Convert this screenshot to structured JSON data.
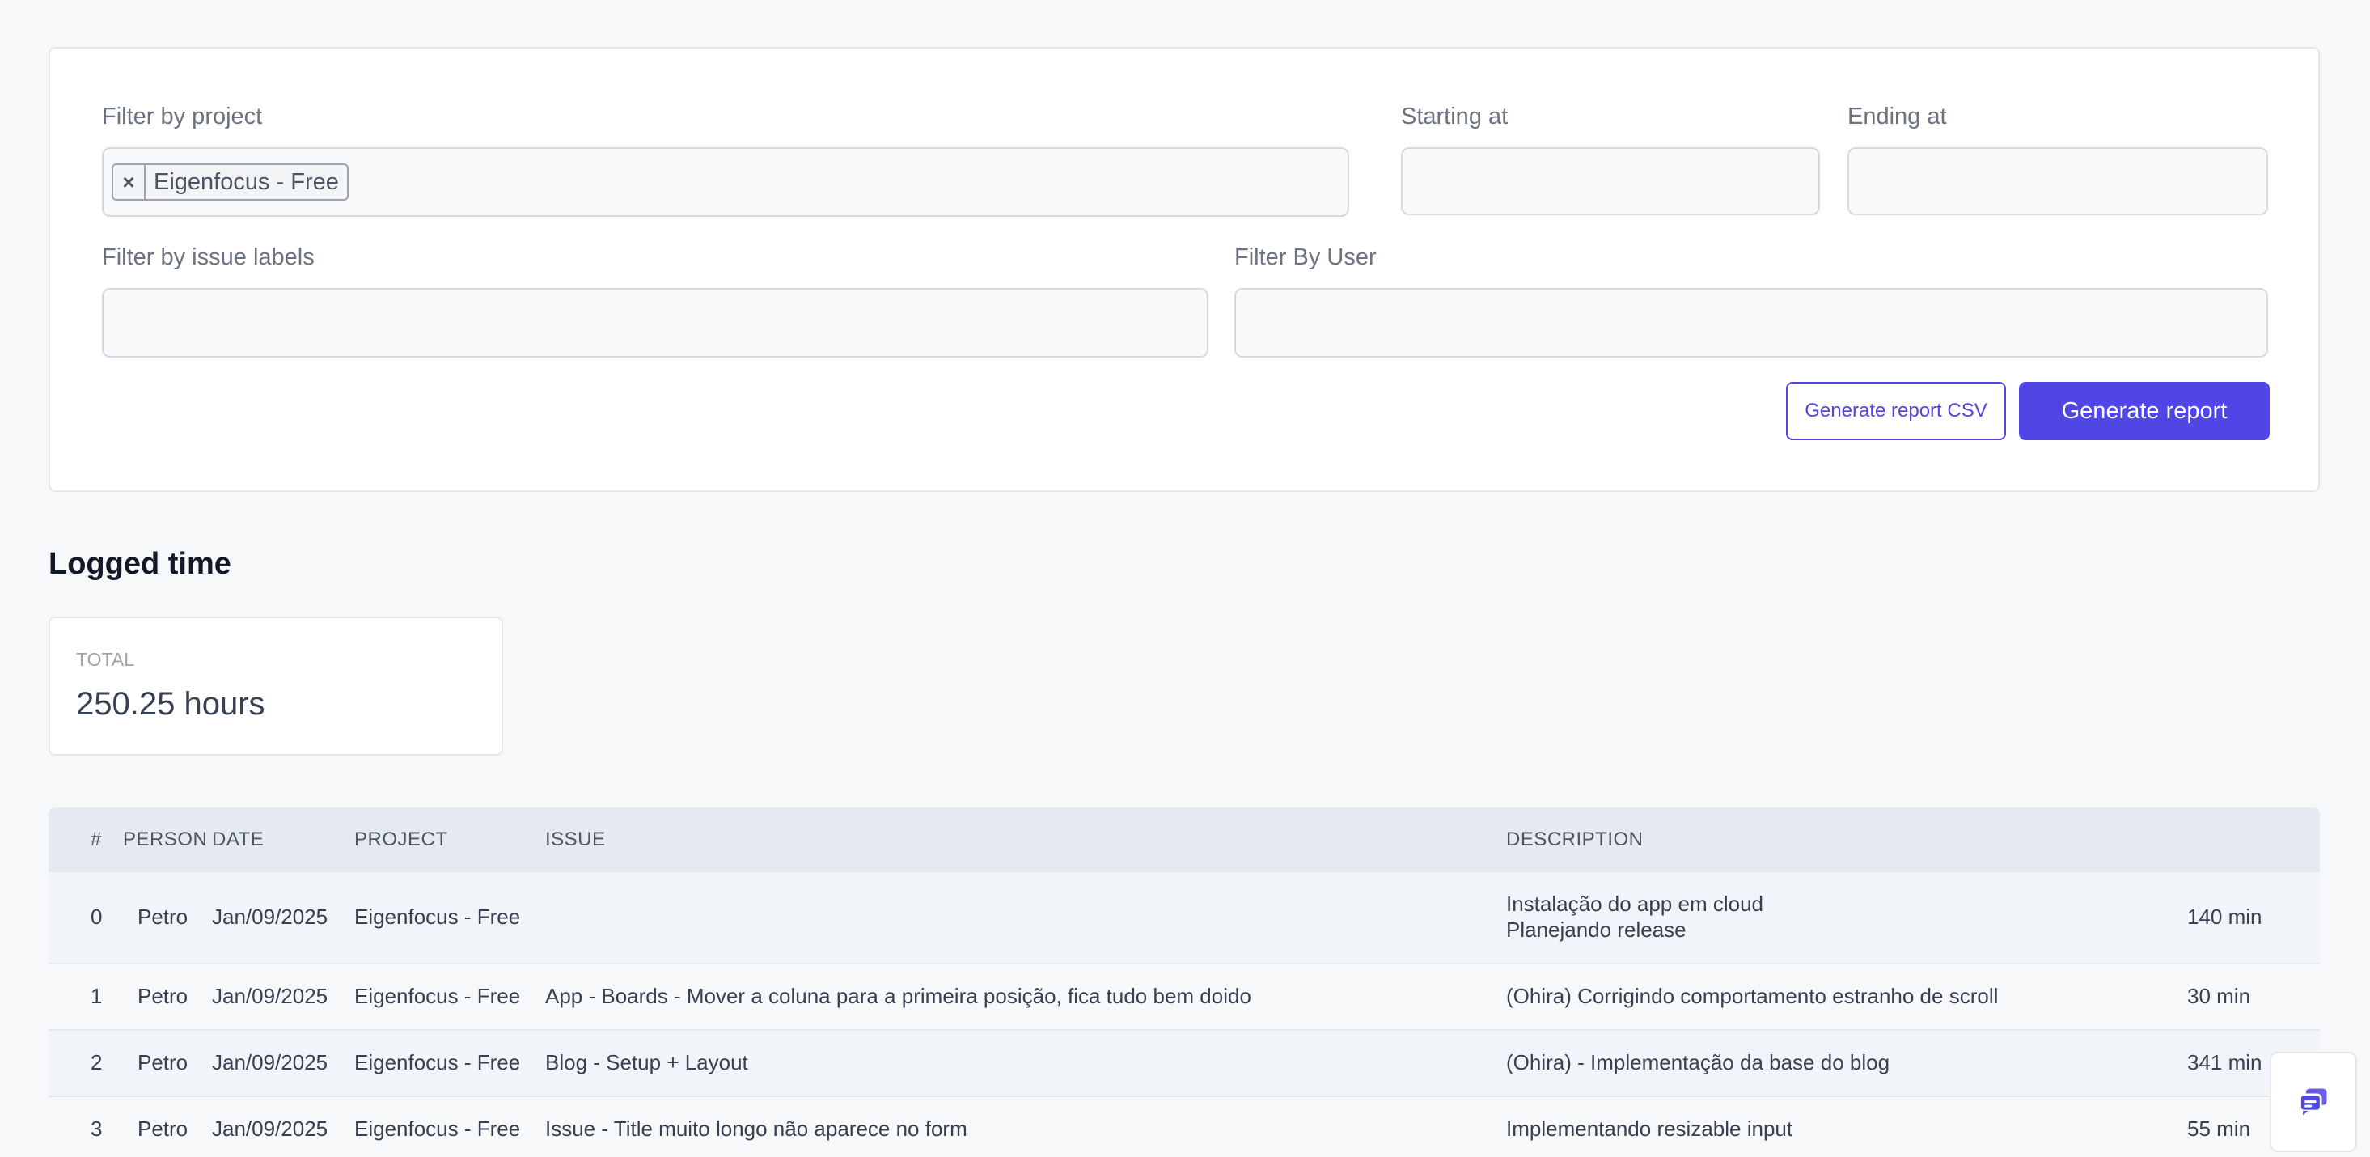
{
  "filters": {
    "project_label": "Filter by project",
    "project_chip": "Eigenfocus - Free",
    "project_chip_remove": "×",
    "starting_label": "Starting at",
    "ending_label": "Ending at",
    "labels_label": "Filter by issue labels",
    "user_label": "Filter By User",
    "csv_button": "Generate report CSV",
    "report_button": "Generate report"
  },
  "logged_time": {
    "title": "Logged time",
    "total_label": "TOTAL",
    "total_value": "250.25 hours"
  },
  "table": {
    "headers": [
      "#",
      "PERSON",
      "DATE",
      "PROJECT",
      "ISSUE",
      "DESCRIPTION"
    ],
    "rows": [
      {
        "num": "0",
        "person": "Petro",
        "date": "Jan/09/2025",
        "project": "Eigenfocus - Free",
        "issue": "",
        "desc_1": "Instalação do app em cloud",
        "desc_2": "Planejando release",
        "duration": "140 min"
      },
      {
        "num": "1",
        "person": "Petro",
        "date": "Jan/09/2025",
        "project": "Eigenfocus - Free",
        "issue": "App - Boards - Mover a coluna para a primeira posição, fica tudo bem doido",
        "desc_1": "(Ohira) Corrigindo comportamento estranho de scroll",
        "duration": "30 min"
      },
      {
        "num": "2",
        "person": "Petro",
        "date": "Jan/09/2025",
        "project": "Eigenfocus - Free",
        "issue": "Blog - Setup + Layout",
        "desc_1": "(Ohira) - Implementação da base do blog",
        "duration": "341 min"
      },
      {
        "num": "3",
        "person": "Petro",
        "date": "Jan/09/2025",
        "project": "Eigenfocus - Free",
        "issue": "Issue - Title muito longo não aparece no form",
        "desc_1": "Implementando resizable input",
        "duration": "55 min"
      }
    ]
  },
  "colors": {
    "accent": "#4f46e5",
    "background": "#f7f8fa",
    "header_bg": "#e5e9f0"
  },
  "icons": {
    "chat": "chat-bubbles-icon"
  }
}
